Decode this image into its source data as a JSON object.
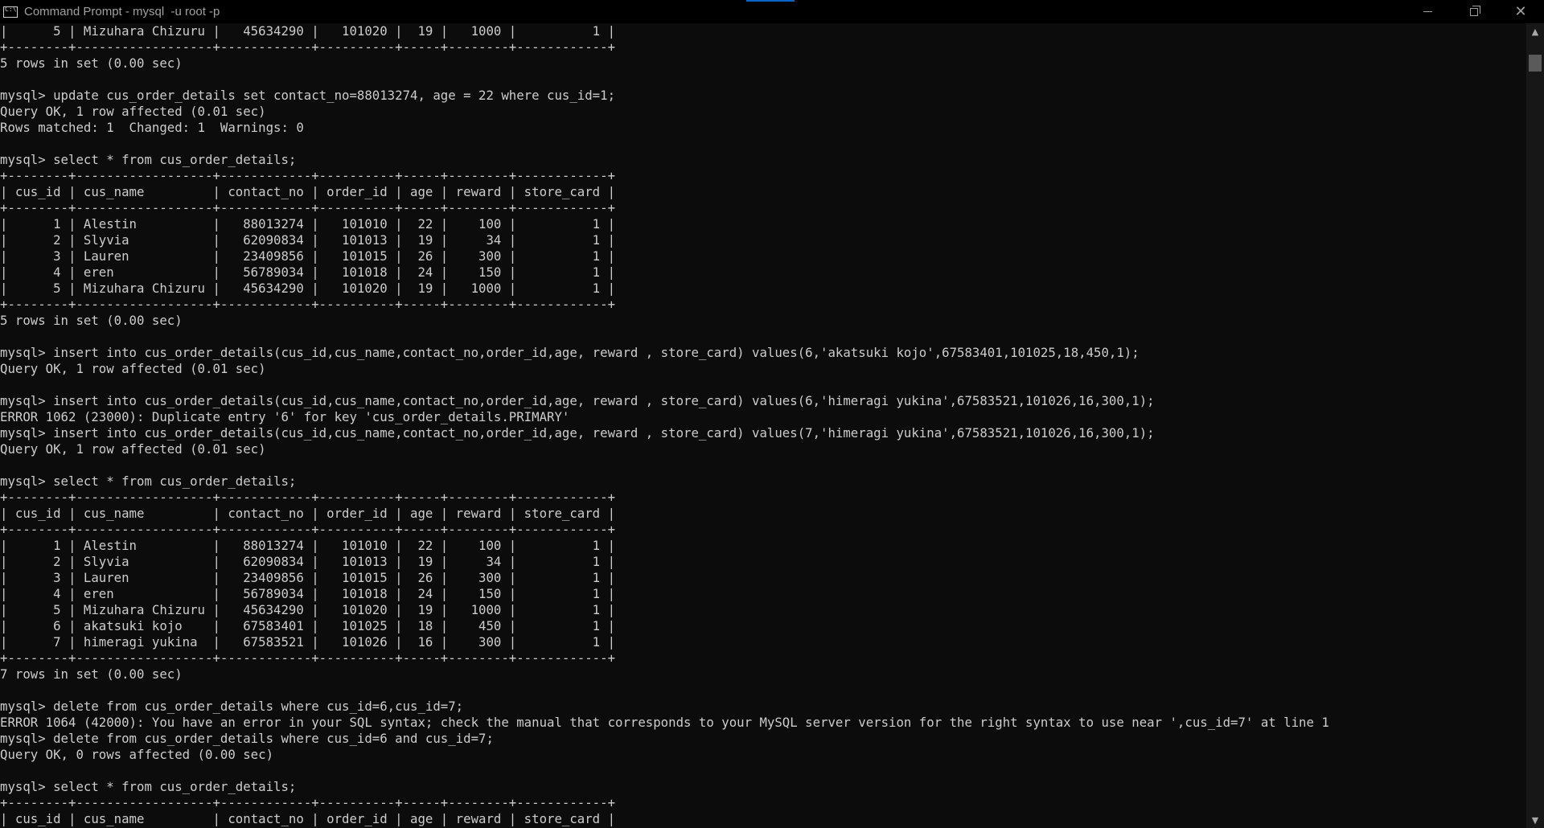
{
  "window": {
    "title": "Command Prompt - mysql  -u root -p"
  },
  "console": {
    "lines": [
      "|      5 | Mizuhara Chizuru |   45634290 |   101020 |  19 |   1000 |          1 |",
      "+--------+------------------+------------+----------+-----+--------+------------+",
      "5 rows in set (0.00 sec)",
      "",
      "mysql> update cus_order_details set contact_no=88013274, age = 22 where cus_id=1;",
      "Query OK, 1 row affected (0.01 sec)",
      "Rows matched: 1  Changed: 1  Warnings: 0",
      "",
      "mysql> select * from cus_order_details;",
      "+--------+------------------+------------+----------+-----+--------+------------+",
      "| cus_id | cus_name         | contact_no | order_id | age | reward | store_card |",
      "+--------+------------------+------------+----------+-----+--------+------------+",
      "|      1 | Alestin          |   88013274 |   101010 |  22 |    100 |          1 |",
      "|      2 | Slyvia           |   62090834 |   101013 |  19 |     34 |          1 |",
      "|      3 | Lauren           |   23409856 |   101015 |  26 |    300 |          1 |",
      "|      4 | eren             |   56789034 |   101018 |  24 |    150 |          1 |",
      "|      5 | Mizuhara Chizuru |   45634290 |   101020 |  19 |   1000 |          1 |",
      "+--------+------------------+------------+----------+-----+--------+------------+",
      "5 rows in set (0.00 sec)",
      "",
      "mysql> insert into cus_order_details(cus_id,cus_name,contact_no,order_id,age, reward , store_card) values(6,'akatsuki kojo',67583401,101025,18,450,1);",
      "Query OK, 1 row affected (0.01 sec)",
      "",
      "mysql> insert into cus_order_details(cus_id,cus_name,contact_no,order_id,age, reward , store_card) values(6,'himeragi yukina',67583521,101026,16,300,1);",
      "ERROR 1062 (23000): Duplicate entry '6' for key 'cus_order_details.PRIMARY'",
      "mysql> insert into cus_order_details(cus_id,cus_name,contact_no,order_id,age, reward , store_card) values(7,'himeragi yukina',67583521,101026,16,300,1);",
      "Query OK, 1 row affected (0.01 sec)",
      "",
      "mysql> select * from cus_order_details;",
      "+--------+------------------+------------+----------+-----+--------+------------+",
      "| cus_id | cus_name         | contact_no | order_id | age | reward | store_card |",
      "+--------+------------------+------------+----------+-----+--------+------------+",
      "|      1 | Alestin          |   88013274 |   101010 |  22 |    100 |          1 |",
      "|      2 | Slyvia           |   62090834 |   101013 |  19 |     34 |          1 |",
      "|      3 | Lauren           |   23409856 |   101015 |  26 |    300 |          1 |",
      "|      4 | eren             |   56789034 |   101018 |  24 |    150 |          1 |",
      "|      5 | Mizuhara Chizuru |   45634290 |   101020 |  19 |   1000 |          1 |",
      "|      6 | akatsuki kojo    |   67583401 |   101025 |  18 |    450 |          1 |",
      "|      7 | himeragi yukina  |   67583521 |   101026 |  16 |    300 |          1 |",
      "+--------+------------------+------------+----------+-----+--------+------------+",
      "7 rows in set (0.00 sec)",
      "",
      "mysql> delete from cus_order_details where cus_id=6,cus_id=7;",
      "ERROR 1064 (42000): You have an error in your SQL syntax; check the manual that corresponds to your MySQL server version for the right syntax to use near ',cus_id=7' at line 1",
      "mysql> delete from cus_order_details where cus_id=6 and cus_id=7;",
      "Query OK, 0 rows affected (0.00 sec)",
      "",
      "mysql> select * from cus_order_details;",
      "+--------+------------------+------------+----------+-----+--------+------------+",
      "| cus_id | cus_name         | contact_no | order_id | age | reward | store_card |"
    ]
  },
  "colors": {
    "background": "#0c0c0c",
    "text": "#cccccc",
    "titlebar": "#000000"
  },
  "icons": {
    "app": "cmd-icon",
    "minimize": "minimize-icon",
    "maximize": "restore-icon",
    "close": "close-icon",
    "scroll_up": "arrow-up-icon",
    "scroll_down": "arrow-down-icon"
  }
}
